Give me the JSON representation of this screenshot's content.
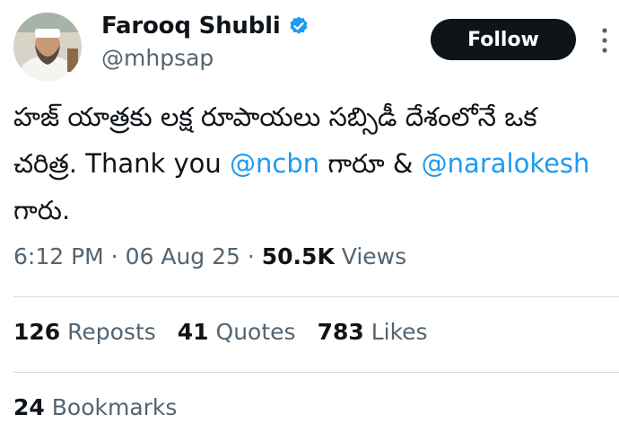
{
  "author": {
    "name": "Farooq Shubli",
    "handle": "@mhpsap"
  },
  "follow_label": "Follow",
  "tweet": {
    "text_1": "హజ్ యాత్రకు లక్ష రూపాయలు సబ్సిడీ దేశంలోనే ఒక చరిత్ర. Thank you ",
    "mention_1": "@ncbn",
    "text_2": " గారూ & ",
    "mention_2": "@naralokesh",
    "text_3": " గారు."
  },
  "meta": {
    "time": "6:12 PM",
    "sep1": " · ",
    "date": "06 Aug 25",
    "sep2": " · ",
    "views_count": "50.5K",
    "views_label": " Views"
  },
  "stats": {
    "reposts_count": "126",
    "reposts_label": " Reposts",
    "quotes_count": "41",
    "quotes_label": " Quotes",
    "likes_count": "783",
    "likes_label": " Likes",
    "bookmarks_count": "24",
    "bookmarks_label": " Bookmarks"
  },
  "colors": {
    "accent": "#1d9bf0",
    "text": "#0f1419",
    "secondary": "#536471",
    "border": "#cfd9de"
  },
  "icons": {
    "verified": "verified-badge-icon",
    "more": "more-options-icon"
  }
}
